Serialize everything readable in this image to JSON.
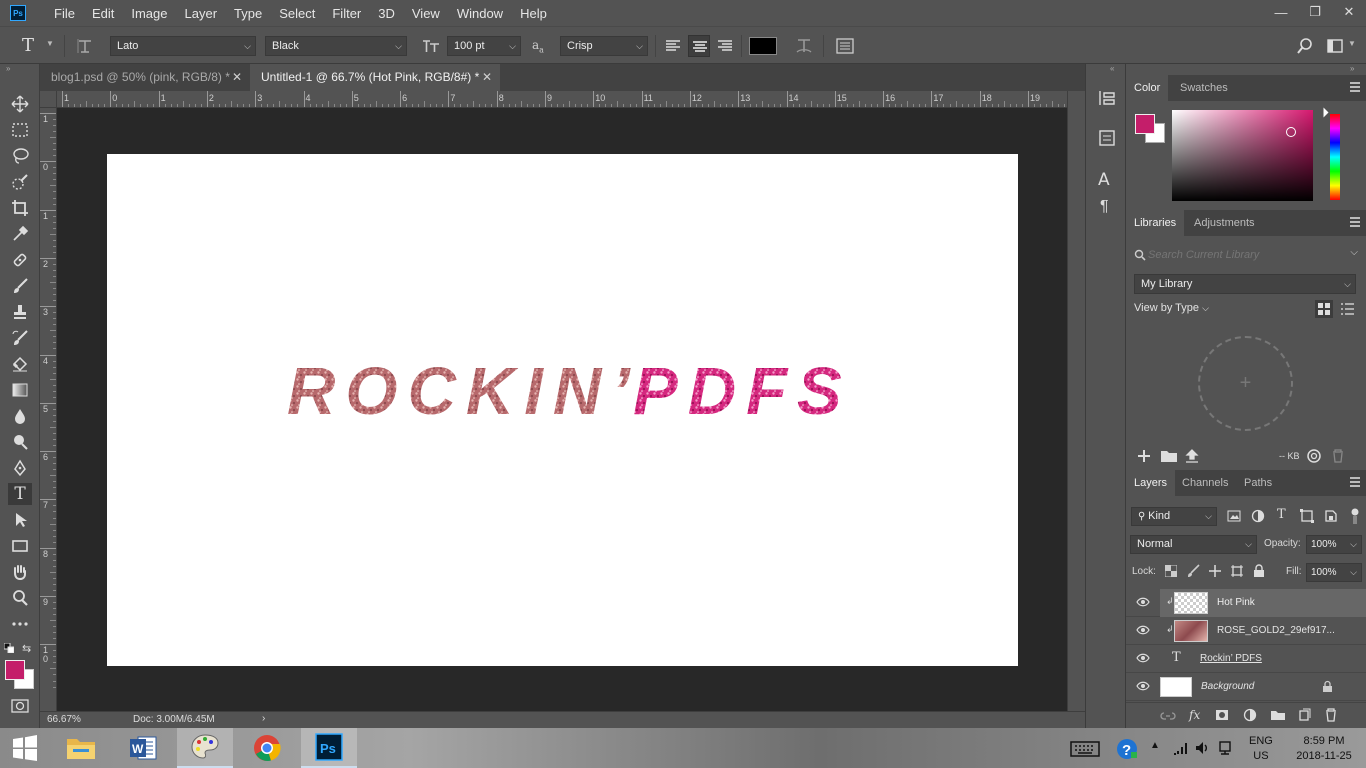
{
  "app": {
    "logo": "Ps"
  },
  "menu": [
    "File",
    "Edit",
    "Image",
    "Layer",
    "Type",
    "Select",
    "Filter",
    "3D",
    "View",
    "Window",
    "Help"
  ],
  "window_controls": {
    "minimize": "—",
    "restore": "❐",
    "close": "✕"
  },
  "options": {
    "tool_glyph": "T",
    "font_family": "Lato",
    "font_style": "Black",
    "font_size": "100 pt",
    "aa_label": "a",
    "antialias": "Crisp",
    "text_color": "#000000"
  },
  "tabs": [
    {
      "label": "blog1.psd @ 50% (pink, RGB/8) *",
      "active": false
    },
    {
      "label": "Untitled-1 @ 66.7% (Hot Pink, RGB/8#) *",
      "active": true
    }
  ],
  "tab_close": "✕",
  "ruler_h": [
    "1",
    "0",
    "1",
    "2",
    "3",
    "4",
    "5",
    "6",
    "7",
    "8",
    "9",
    "10",
    "11",
    "12",
    "13",
    "14",
    "15",
    "16",
    "17",
    "18",
    "19"
  ],
  "ruler_v": [
    "1",
    "0",
    "1",
    "2",
    "3",
    "4",
    "5",
    "6",
    "7",
    "8",
    "9",
    "1\n0"
  ],
  "canvas": {
    "text_part1": "ROCKIN’",
    "text_part2": "PDFS",
    "color_part1": "#b8696b",
    "color_part2": "#d8277f"
  },
  "status": {
    "zoom": "66.67%",
    "doc": "Doc: 3.00M/6.45M",
    "arrow": "›"
  },
  "foreground_color": "#c41e6a",
  "background_color": "#ffffff",
  "panels": {
    "color_tabs": [
      "Color",
      "Swatches"
    ],
    "color_fg": "#c41e6a",
    "library_tabs": [
      "Libraries",
      "Adjustments"
    ],
    "library_search_placeholder": "Search Current Library",
    "library_name": "My Library",
    "view_by": "View by Type",
    "library_size": "-- KB",
    "add_glyph": "+",
    "layer_tabs": [
      "Layers",
      "Channels",
      "Paths"
    ],
    "kind_label": "Kind",
    "blend_mode": "Normal",
    "opacity_label": "Opacity:",
    "opacity": "100%",
    "lock_label": "Lock:",
    "fill_label": "Fill:",
    "fill": "100%",
    "layers": [
      {
        "name": "Hot Pink",
        "selected": true,
        "type": "smart"
      },
      {
        "name": "ROSE_GOLD2_29ef917...",
        "selected": false,
        "type": "smart"
      },
      {
        "name": "Rockin’ PDFS",
        "selected": false,
        "type": "text",
        "type_glyph": "T"
      },
      {
        "name": "Background",
        "selected": false,
        "type": "background"
      }
    ],
    "layer_footer": [
      "link",
      "fx",
      "mask",
      "adjustment",
      "folder",
      "new",
      "trash"
    ]
  },
  "taskbar": {
    "lang": "ENG",
    "region": "US",
    "time": "8:59 PM",
    "date": "2018-11-25"
  }
}
